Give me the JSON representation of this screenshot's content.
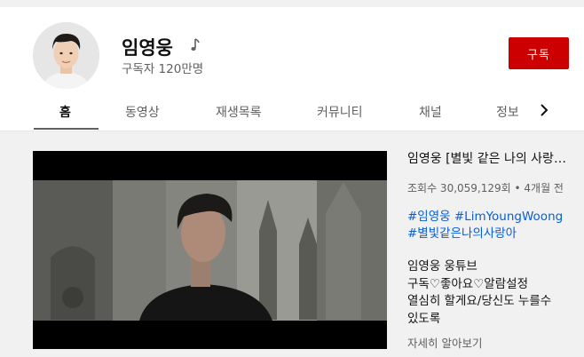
{
  "channel": {
    "name": "임영웅",
    "subscribers": "구독자 120만명",
    "subscribe_label": "구독"
  },
  "tabs": [
    "홈",
    "동영상",
    "재생목록",
    "커뮤니티",
    "채널",
    "정보"
  ],
  "video": {
    "title": "임영웅 [별빛 같은 나의 사랑…",
    "meta": "조회수 30,059,129회 • 4개월 전",
    "hashtags": [
      "#임영웅 #LimYoungWoong",
      "#별빛같은나의사랑아"
    ],
    "description": [
      "임영웅 웅튜브",
      "구독♡좋아요♡알람설정",
      "열심히 할게요/당신도 누를수",
      "있도록"
    ],
    "more_label": "자세히 알아보기"
  },
  "colors": {
    "subscribe": "#cc0000",
    "hashtag": "#065fd4",
    "muted": "#606060"
  }
}
